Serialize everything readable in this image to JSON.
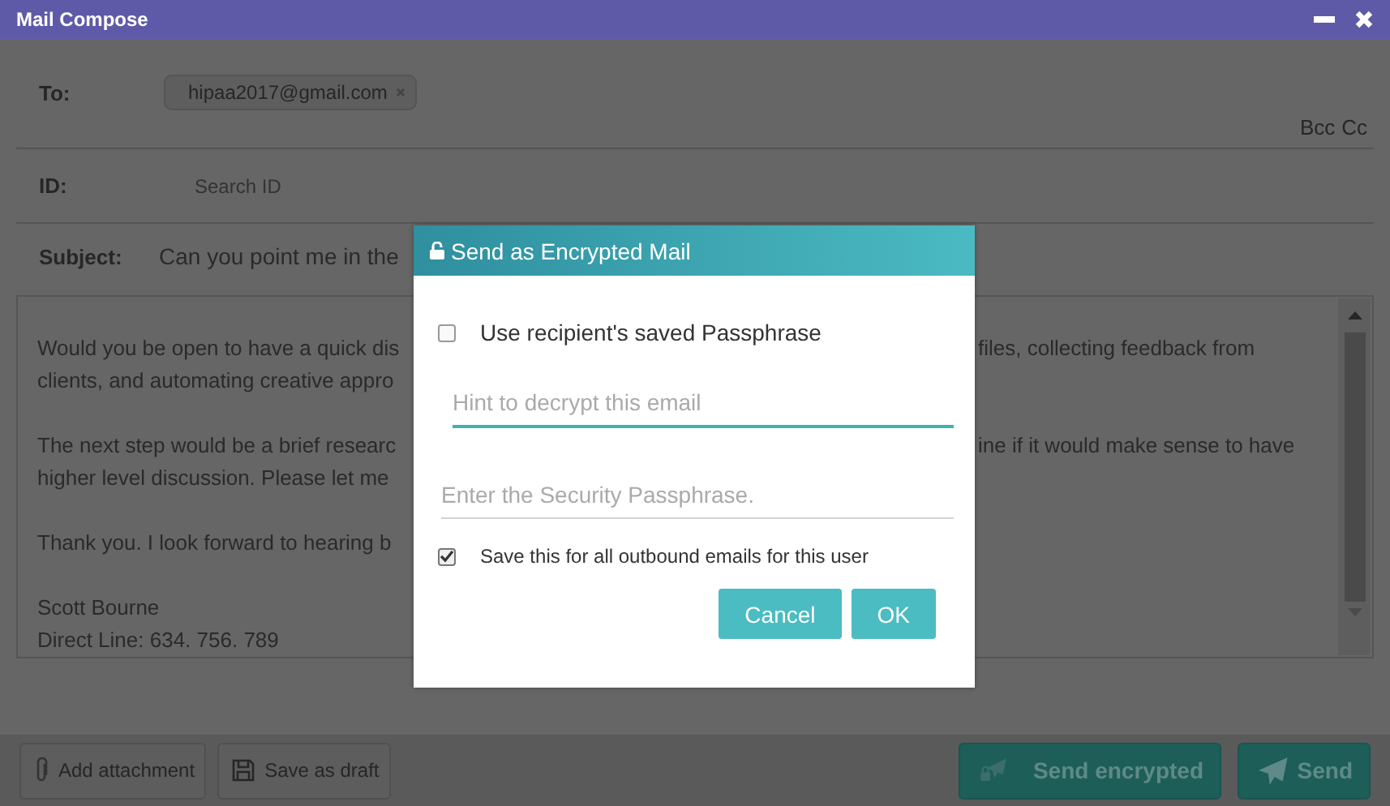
{
  "window": {
    "title": "Mail Compose"
  },
  "compose": {
    "to": {
      "label": "To:",
      "recipients": [
        "hipaa2017@gmail.com"
      ],
      "links": [
        "Bcc",
        "Cc"
      ]
    },
    "id": {
      "label": "ID:",
      "placeholder": "Search ID"
    },
    "subject": {
      "label": "Subject:",
      "value": "Can you point me in the"
    },
    "body": {
      "paragraphs": [
        [
          {
            "left": "Would you be open to have a quick dis",
            "right": "files, collecting feedback from"
          },
          {
            "left": "clients, and automating creative appro"
          }
        ],
        [
          {
            "left": "The next step would be a brief researc",
            "right": "ine if it would make sense to have"
          },
          {
            "left": "higher level discussion. Please let me"
          }
        ],
        [
          {
            "left": "Thank you. I look forward to hearing b"
          }
        ],
        [
          {
            "left": "Scott Bourne"
          },
          {
            "left": "Direct Line: 634. 756. 789"
          }
        ]
      ]
    }
  },
  "footer": {
    "buttons": [
      {
        "label": "Add attachment",
        "kind": "attach"
      },
      {
        "label": "Save as draft",
        "kind": "draft"
      },
      {
        "label": "Send encrypted",
        "kind": "send-encrypted"
      },
      {
        "label": "Send",
        "kind": "send"
      }
    ]
  },
  "dialog": {
    "title": "Send as Encrypted Mail",
    "use_saved": {
      "label": "Use recipient's saved Passphrase",
      "checked": false
    },
    "hint": {
      "placeholder": "Hint to decrypt this email",
      "focused": true
    },
    "passphrase": {
      "placeholder": "Enter the Security Passphrase.",
      "focused": false
    },
    "save_all": {
      "label": "Save this for all outbound emails for this user",
      "checked": true
    },
    "buttons": [
      "Cancel",
      "OK"
    ]
  }
}
